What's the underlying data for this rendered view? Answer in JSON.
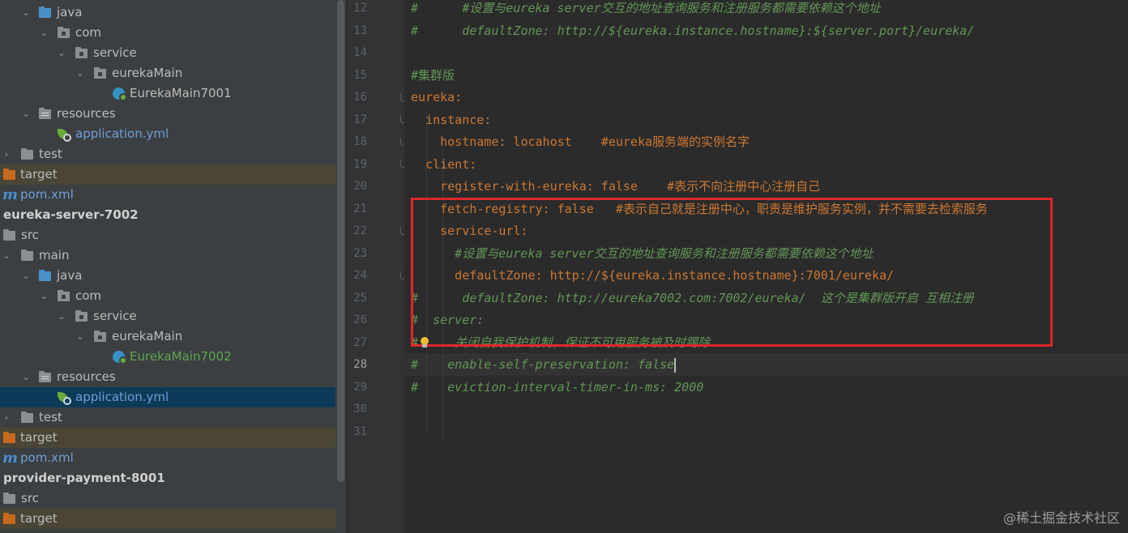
{
  "project_tree": {
    "items": [
      {
        "label": "java",
        "expanded": true,
        "icon": "source-folder-icon"
      },
      {
        "label": "com",
        "expanded": true,
        "icon": "package-icon"
      },
      {
        "label": "service",
        "expanded": true,
        "icon": "package-icon"
      },
      {
        "label": "eurekaMain",
        "expanded": true,
        "icon": "package-icon"
      },
      {
        "label": "EurekaMain7001",
        "icon": "spring-boot-class-icon"
      },
      {
        "label": "resources",
        "expanded": true,
        "icon": "resources-folder-icon"
      },
      {
        "label": "application.yml",
        "icon": "spring-yml-icon"
      },
      {
        "label": "test",
        "expanded": false,
        "icon": "folder-icon"
      },
      {
        "label": "target",
        "icon": "excluded-folder-icon"
      },
      {
        "label": "pom.xml",
        "icon": "maven-icon"
      },
      {
        "label": "eureka-server-7002",
        "icon": "module"
      },
      {
        "label": "src",
        "icon": "folder-icon"
      },
      {
        "label": "main",
        "expanded": true,
        "icon": "folder-icon"
      },
      {
        "label": "java",
        "expanded": true,
        "icon": "source-folder-icon"
      },
      {
        "label": "com",
        "expanded": true,
        "icon": "package-icon"
      },
      {
        "label": "service",
        "expanded": true,
        "icon": "package-icon"
      },
      {
        "label": "eurekaMain",
        "expanded": true,
        "icon": "package-icon"
      },
      {
        "label": "EurekaMain7002",
        "icon": "spring-boot-class-icon"
      },
      {
        "label": "resources",
        "expanded": true,
        "icon": "resources-folder-icon"
      },
      {
        "label": "application.yml",
        "icon": "spring-yml-icon",
        "selected": true
      },
      {
        "label": "test",
        "expanded": false,
        "icon": "folder-icon"
      },
      {
        "label": "target",
        "icon": "excluded-folder-icon"
      },
      {
        "label": "pom.xml",
        "icon": "maven-icon"
      },
      {
        "label": "provider-payment-8001",
        "icon": "module"
      },
      {
        "label": "src",
        "icon": "folder-icon"
      },
      {
        "label": "target",
        "icon": "excluded-folder-icon"
      }
    ]
  },
  "editor": {
    "current_line": "28",
    "lines": [
      {
        "num": "12",
        "text": "#      #设置与eureka server交互的地址查询服务和注册服务都需要依赖这个地址"
      },
      {
        "num": "13",
        "text": "#      defaultZone: http://${eureka.instance.hostname}:${server.port}/eureka/"
      },
      {
        "num": "14",
        "text": ""
      },
      {
        "num": "15",
        "text": "#集群版"
      },
      {
        "num": "16",
        "text": "eureka:"
      },
      {
        "num": "17",
        "text": "  instance:"
      },
      {
        "num": "18",
        "text": "    hostname: locahost    #eureka服务端的实例名字"
      },
      {
        "num": "19",
        "text": "  client:"
      },
      {
        "num": "20",
        "text": "    register-with-eureka: false    #表示不向注册中心注册自己"
      },
      {
        "num": "21",
        "text": "    fetch-registry: false   #表示自己就是注册中心，职责是维护服务实例，并不需要去检索服务"
      },
      {
        "num": "22",
        "text": "    service-url:"
      },
      {
        "num": "23",
        "text": "      #设置与eureka server交互的地址查询服务和注册服务都需要依赖这个地址"
      },
      {
        "num": "24",
        "text": "      defaultZone: http://${eureka.instance.hostname}:7001/eureka/"
      },
      {
        "num": "25",
        "text": "#      defaultZone: http://eureka7002.com:7002/eureka/  这个是集群版开启 互相注册"
      },
      {
        "num": "26",
        "text": "#  server:"
      },
      {
        "num": "27",
        "text": "#     关闭自我保护机制，保证不可用服务被及时踢除"
      },
      {
        "num": "28",
        "text": "#    enable-self-preservation: false"
      },
      {
        "num": "29",
        "text": "#    eviction-interval-timer-in-ms: 2000"
      },
      {
        "num": "30",
        "text": ""
      },
      {
        "num": "31",
        "text": ""
      }
    ]
  },
  "watermark": "@稀土掘金技术社区",
  "colors": {
    "sidebar_bg": "#3c3f41",
    "editor_bg": "#2b2b2b",
    "comment": "#629755",
    "keyword": "#cc7832",
    "highlight_box": "#e0262a",
    "selection": "#0d3a58"
  }
}
